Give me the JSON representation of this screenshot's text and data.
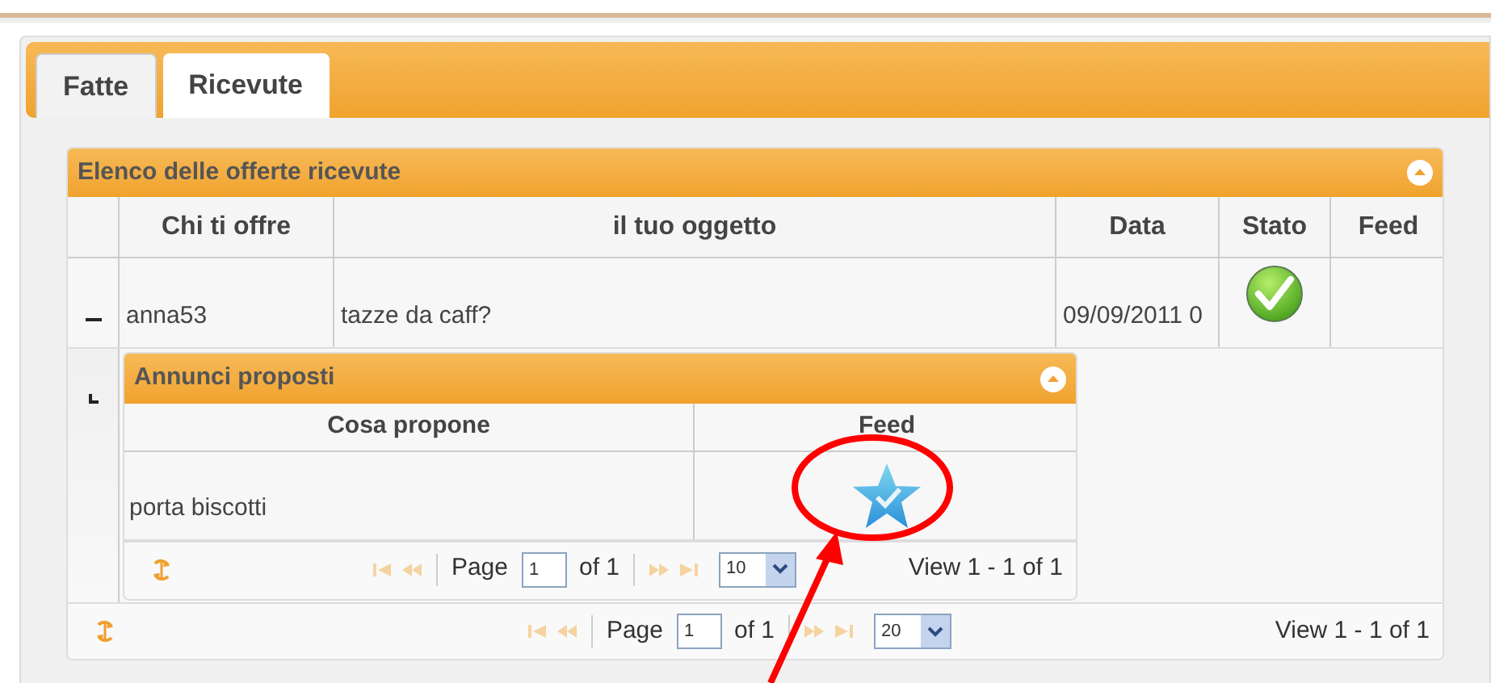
{
  "tabs": [
    {
      "label": "Fatte",
      "selected": false
    },
    {
      "label": "Ricevute",
      "selected": true
    }
  ],
  "grid": {
    "title": "Elenco delle offerte ricevute",
    "collapsed": false,
    "columns": [
      "Chi ti offre",
      "il tuo oggetto",
      "Data",
      "Stato",
      "Feed"
    ],
    "rows": [
      {
        "expanded": true,
        "cells": [
          "anna53",
          "tazze da caff?",
          "09/09/2011 0"
        ],
        "status": {
          "kind": "check"
        },
        "subgrid": {
          "title": "Annunci proposti",
          "collapsed": false,
          "columns": [
            "Cosa propone",
            "Feed"
          ],
          "rows": [
            {
              "cells": [
                "porta biscotti"
              ],
              "feed": {
                "kind": "star"
              }
            }
          ],
          "pager": {
            "page_label": "Page",
            "page": "1",
            "of": "of 1",
            "page_size": "10",
            "view": "View 1 - 1 of 1"
          }
        }
      }
    ],
    "pager": {
      "page_label": "Page",
      "page": "1",
      "of": "of 1",
      "page_size": "20",
      "view": "View 1 - 1 of 1"
    }
  }
}
